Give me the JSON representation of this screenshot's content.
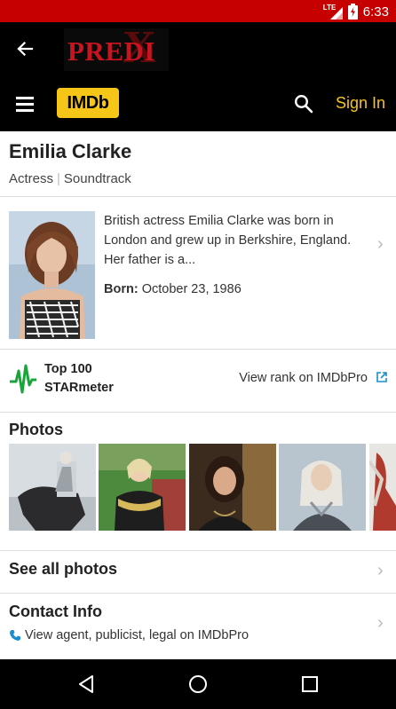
{
  "status_bar": {
    "network": "LTE",
    "time": "6:33",
    "color": "#c60000"
  },
  "app_bar": {
    "back_icon": "arrow-left-icon",
    "logo_text": "PREDI",
    "logo_mark": "X"
  },
  "imdb_bar": {
    "menu_icon": "hamburger-icon",
    "logo": "IMDb",
    "search_icon": "search-icon",
    "sign_in": "Sign In",
    "accent": "#f5c518"
  },
  "person": {
    "name": "Emilia Clarke",
    "roles": [
      "Actress",
      "Soundtrack"
    ],
    "bio": "British actress Emilia Clarke was born in London and grew up in Berkshire, England. Her father is a...",
    "born_label": "Born:",
    "born_value": "October 23, 1986"
  },
  "starmeter": {
    "title_line1": "Top 100",
    "title_line2": "STARmeter",
    "link": "View rank on IMDbPro",
    "icon": "starmeter-pulse-icon",
    "link_icon": "external-link-icon"
  },
  "photos": {
    "title": "Photos",
    "thumbnails": [
      "photo-horse-rider",
      "photo-red-carpet",
      "photo-film-still",
      "photo-white-hair",
      "photo-partial"
    ]
  },
  "see_all_photos": "See all photos",
  "contact": {
    "title": "Contact Info",
    "subtitle": "View agent, publicist, legal on IMDbPro",
    "icon": "phone-icon"
  },
  "nav_bar": {
    "back": "nav-back-icon",
    "home": "nav-home-icon",
    "recents": "nav-recents-icon"
  }
}
